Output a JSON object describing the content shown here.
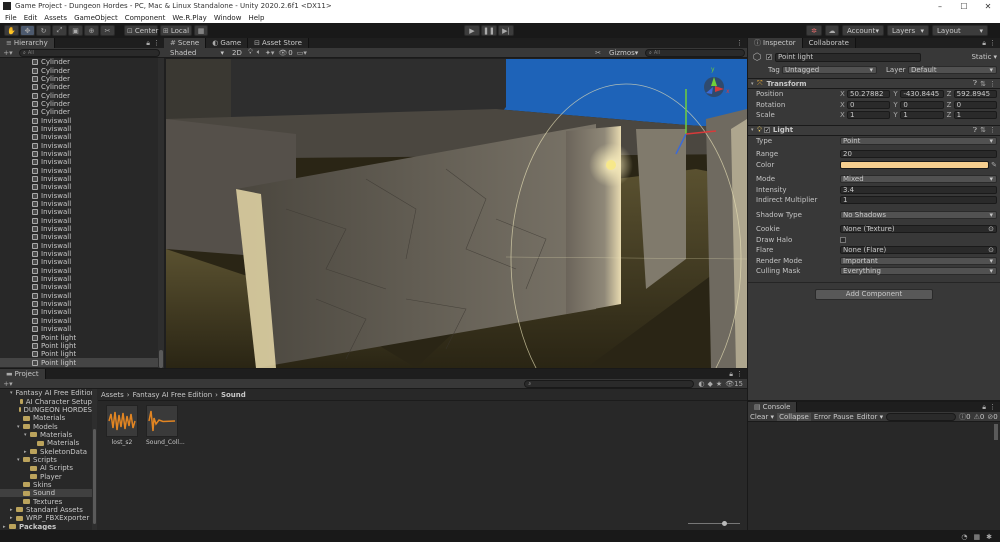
{
  "titlebar": {
    "text": "Game Project - Dungeon Hordes - PC, Mac & Linux Standalone - Unity 2020.2.6f1 <DX11>",
    "minimize": "–",
    "maximize": "☐",
    "close": "✕"
  },
  "menu": [
    "File",
    "Edit",
    "Assets",
    "GameObject",
    "Component",
    "We.R.Play",
    "Window",
    "Help"
  ],
  "toolbar": {
    "pivot": "Center",
    "space": "Local",
    "account": "Account",
    "layers": "Layers",
    "layout": "Layout"
  },
  "hierarchy": {
    "tab": "Hierarchy",
    "search_placeholder": "All",
    "items": [
      "Cylinder",
      "Cylinder",
      "Cylinder",
      "Cylinder",
      "Cylinder",
      "Cylinder",
      "Cylinder",
      "Inviswall",
      "Inviswall",
      "Inviswall",
      "Inviswall",
      "Inviswall",
      "Inviswall",
      "Inviswall",
      "Inviswall",
      "Inviswall",
      "Inviswall",
      "Inviswall",
      "Inviswall",
      "Inviswall",
      "Inviswall",
      "Inviswall",
      "Inviswall",
      "Inviswall",
      "Inviswall",
      "Inviswall",
      "Inviswall",
      "Inviswall",
      "Inviswall",
      "Inviswall",
      "Inviswall",
      "Inviswall",
      "Inviswall",
      "Point light",
      "Point light",
      "Point light",
      "Point light"
    ],
    "selected_index": 36
  },
  "scene": {
    "tabs": [
      "Scene",
      "Game",
      "Asset Store"
    ],
    "shading": "Shaded",
    "mode2d": "2D",
    "gizmos": "Gizmos",
    "search_placeholder": "All",
    "hidden_count": "0",
    "colors": {
      "sky": "#1e63b8",
      "floor": "#3a3522",
      "wall": "#7a7468"
    }
  },
  "project": {
    "tab": "Project",
    "count_badge": "15",
    "breadcrumb": [
      "Assets",
      "Fantasy AI Free Edition",
      "Sound"
    ],
    "tree": [
      {
        "label": "Fantasy AI Free Edition",
        "indent": 2,
        "arrow": "▾"
      },
      {
        "label": "AI Character Setup",
        "indent": 3,
        "arrow": ""
      },
      {
        "label": "DUNGEON HORDES",
        "indent": 3,
        "arrow": ""
      },
      {
        "label": "Materials",
        "indent": 3,
        "arrow": ""
      },
      {
        "label": "Models",
        "indent": 3,
        "arrow": "▾"
      },
      {
        "label": "Materials",
        "indent": 4,
        "arrow": "▾"
      },
      {
        "label": "Materials",
        "indent": 5,
        "arrow": ""
      },
      {
        "label": "SkeletonData",
        "indent": 4,
        "arrow": "▸"
      },
      {
        "label": "Scripts",
        "indent": 3,
        "arrow": "▾"
      },
      {
        "label": "AI Scripts",
        "indent": 4,
        "arrow": ""
      },
      {
        "label": "Player",
        "indent": 4,
        "arrow": ""
      },
      {
        "label": "Skins",
        "indent": 3,
        "arrow": ""
      },
      {
        "label": "Sound",
        "indent": 3,
        "arrow": ""
      },
      {
        "label": "Textures",
        "indent": 3,
        "arrow": ""
      },
      {
        "label": "Standard Assets",
        "indent": 2,
        "arrow": "▸"
      },
      {
        "label": "WRP_FBXExporter",
        "indent": 2,
        "arrow": "▸"
      },
      {
        "label": "Packages",
        "indent": 1,
        "arrow": "▸"
      }
    ],
    "selected_tree_index": 12,
    "assets": [
      {
        "label": "lost_s2",
        "color": "#e28522"
      },
      {
        "label": "Sound_Coll...",
        "color": "#e28522"
      }
    ]
  },
  "inspector": {
    "tabs": [
      "Inspector",
      "Collaborate"
    ],
    "object_name": "Point light",
    "static_label": "Static",
    "tag_label": "Tag",
    "tag_value": "Untagged",
    "layer_label": "Layer",
    "layer_value": "Default",
    "transform": {
      "title": "Transform",
      "position_label": "Position",
      "position": {
        "x": "50.27882",
        "y": "-430.8445",
        "z": "592.8945"
      },
      "rotation_label": "Rotation",
      "rotation": {
        "x": "0",
        "y": "0",
        "z": "0"
      },
      "scale_label": "Scale",
      "scale": {
        "x": "1",
        "y": "1",
        "z": "1"
      }
    },
    "light": {
      "title": "Light",
      "type_label": "Type",
      "type_value": "Point",
      "range_label": "Range",
      "range_value": "20",
      "color_label": "Color",
      "color_value": "#f6cf8f",
      "mode_label": "Mode",
      "mode_value": "Mixed",
      "intensity_label": "Intensity",
      "intensity_value": "3.4",
      "indirect_label": "Indirect Multiplier",
      "indirect_value": "1",
      "shadow_label": "Shadow Type",
      "shadow_value": "No Shadows",
      "cookie_label": "Cookie",
      "cookie_value": "None (Texture)",
      "halo_label": "Draw Halo",
      "flare_label": "Flare",
      "flare_value": "None (Flare)",
      "render_label": "Render Mode",
      "render_value": "Important",
      "culling_label": "Culling Mask",
      "culling_value": "Everything"
    },
    "add_component": "Add Component"
  },
  "console": {
    "tab": "Console",
    "clear": "Clear",
    "collapse": "Collapse",
    "error_pause": "Error Pause",
    "editor": "Editor",
    "count_log": "0",
    "count_warn": "0",
    "count_err": "0"
  }
}
